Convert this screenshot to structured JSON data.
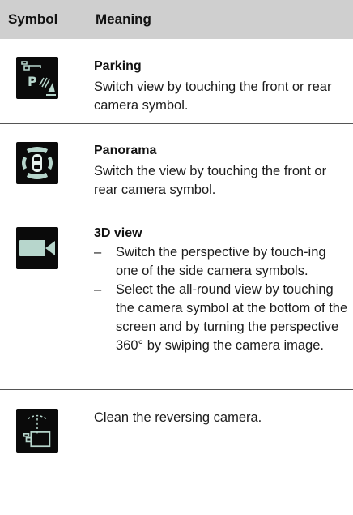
{
  "table": {
    "headers": {
      "symbol": "Symbol",
      "meaning": "Meaning"
    },
    "rows": [
      {
        "icon": "parking-camera-icon",
        "title": "Parking",
        "text": "Switch view by touching the front or rear camera symbol."
      },
      {
        "icon": "panorama-car-icon",
        "title": "Panorama",
        "text": "Switch the view by touching the front or rear camera symbol."
      },
      {
        "icon": "video-camera-icon",
        "title": "3D view",
        "bullets": [
          {
            "dash": "–",
            "text": "Switch the perspective by touch-ing one of the side camera symbols."
          },
          {
            "dash": "–",
            "text": "Select the all-round view by touching the camera symbol at the bottom of the screen and by turning the perspective 360° by swiping the camera image."
          }
        ]
      },
      {
        "icon": "camera-cleaning-icon",
        "text": "Clean the reversing camera."
      }
    ]
  },
  "colors": {
    "header_bg": "#cfcfcf",
    "icon_bg": "#0a0a0a",
    "icon_fg": "#b7d6cc",
    "rule": "#555555"
  }
}
